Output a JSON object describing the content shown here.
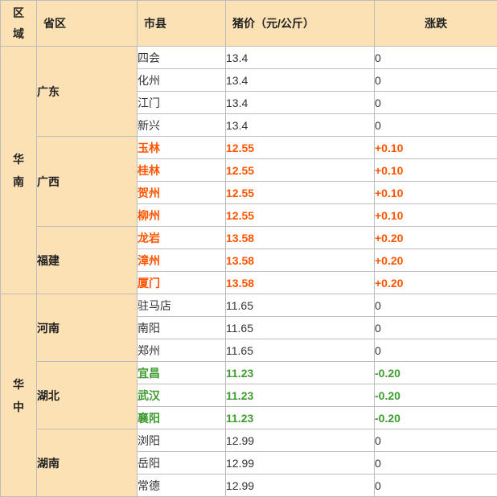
{
  "headers": {
    "region_top": "区",
    "region_bottom": "域",
    "province": "省区",
    "city": "市县",
    "price": "猪价（元/公斤）",
    "change": "涨跌"
  },
  "regions": [
    {
      "name_top": "华",
      "name_bottom": "南",
      "provinces": [
        {
          "name": "广东",
          "cities": [
            {
              "city": "四会",
              "price": "13.4",
              "change": "0",
              "trend": "flat"
            },
            {
              "city": "化州",
              "price": "13.4",
              "change": "0",
              "trend": "flat"
            },
            {
              "city": "江门",
              "price": "13.4",
              "change": "0",
              "trend": "flat"
            },
            {
              "city": "新兴",
              "price": "13.4",
              "change": "0",
              "trend": "flat"
            }
          ]
        },
        {
          "name": "广西",
          "cities": [
            {
              "city": "玉林",
              "price": "12.55",
              "change": "+0.10",
              "trend": "up"
            },
            {
              "city": "桂林",
              "price": "12.55",
              "change": "+0.10",
              "trend": "up"
            },
            {
              "city": "贺州",
              "price": "12.55",
              "change": "+0.10",
              "trend": "up"
            },
            {
              "city": "柳州",
              "price": "12.55",
              "change": "+0.10",
              "trend": "up"
            }
          ]
        },
        {
          "name": "福建",
          "cities": [
            {
              "city": "龙岩",
              "price": "13.58",
              "change": "+0.20",
              "trend": "up"
            },
            {
              "city": "漳州",
              "price": "13.58",
              "change": "+0.20",
              "trend": "up"
            },
            {
              "city": "厦门",
              "price": "13.58",
              "change": "+0.20",
              "trend": "up"
            }
          ]
        }
      ]
    },
    {
      "name_top": "华",
      "name_bottom": "中",
      "provinces": [
        {
          "name": "河南",
          "cities": [
            {
              "city": "驻马店",
              "price": "11.65",
              "change": "0",
              "trend": "flat"
            },
            {
              "city": "南阳",
              "price": "11.65",
              "change": "0",
              "trend": "flat"
            },
            {
              "city": "郑州",
              "price": "11.65",
              "change": "0",
              "trend": "flat"
            }
          ]
        },
        {
          "name": "湖北",
          "cities": [
            {
              "city": "宜昌",
              "price": "11.23",
              "change": "-0.20",
              "trend": "down"
            },
            {
              "city": "武汉",
              "price": "11.23",
              "change": "-0.20",
              "trend": "down"
            },
            {
              "city": "襄阳",
              "price": "11.23",
              "change": "-0.20",
              "trend": "down"
            }
          ]
        },
        {
          "name": "湖南",
          "cities": [
            {
              "city": "浏阳",
              "price": "12.99",
              "change": "0",
              "trend": "flat"
            },
            {
              "city": "岳阳",
              "price": "12.99",
              "change": "0",
              "trend": "flat"
            },
            {
              "city": "常德",
              "price": "12.99",
              "change": "0",
              "trend": "flat"
            }
          ]
        }
      ]
    }
  ]
}
